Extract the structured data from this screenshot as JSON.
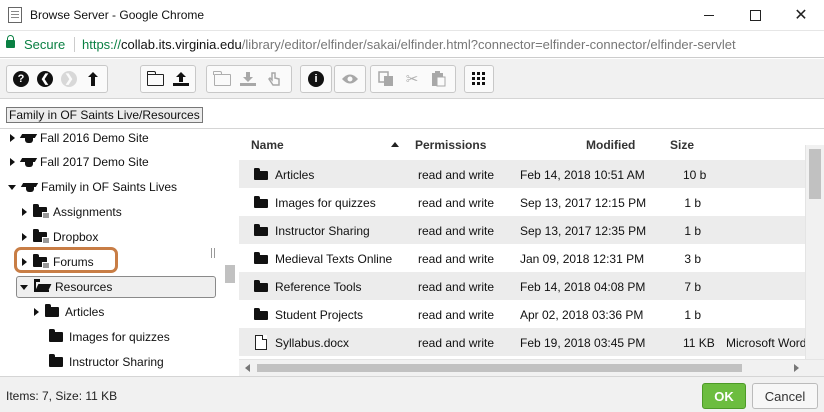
{
  "window": {
    "title": "Browse Server - Google Chrome",
    "controls": {
      "minimize": "minimize",
      "maximize": "maximize",
      "close": "✕"
    }
  },
  "address": {
    "secure_label": "Secure",
    "url_scheme": "https://",
    "url_host": "collab.its.virginia.edu",
    "url_path": "/library/editor/elfinder/sakai/elfinder.html?connector=elfinder-connector/elfinder-servlet"
  },
  "toolbar": {
    "groups": [
      [
        "help-icon",
        "back-icon",
        "forward-icon",
        "up-icon"
      ],
      [
        "new-folder-icon",
        "upload-icon"
      ],
      [
        "open-icon",
        "download-icon",
        "getfile-icon"
      ],
      [
        "info-icon"
      ],
      [
        "preview-icon"
      ],
      [
        "copy-icon",
        "cut-icon",
        "paste-icon"
      ],
      [
        "view-icon"
      ]
    ]
  },
  "path": {
    "crumb": "Family in OF Saints Live/Resources"
  },
  "tree": {
    "items": [
      {
        "label": "Fall 2016 Demo Site",
        "icon": "site-icon"
      },
      {
        "label": "Fall 2017 Demo Site",
        "icon": "site-icon"
      },
      {
        "label": "Family in OF Saints Lives",
        "icon": "site-icon"
      },
      {
        "label": "Assignments",
        "icon": "folder-icon"
      },
      {
        "label": "Dropbox",
        "icon": "folder-icon"
      },
      {
        "label": "Forums",
        "icon": "folder-icon"
      },
      {
        "label": "Resources",
        "icon": "folder-open-icon"
      },
      {
        "label": "Articles",
        "icon": "folder-icon"
      },
      {
        "label": "Images for quizzes",
        "icon": "folder-icon"
      },
      {
        "label": "Instructor Sharing",
        "icon": "folder-icon"
      }
    ]
  },
  "files": {
    "columns": {
      "name": "Name",
      "permissions": "Permissions",
      "modified": "Modified",
      "size": "Size"
    },
    "rows": [
      {
        "name": "Articles",
        "permissions": "read and write",
        "modified": "Feb 14, 2018 10:51 AM",
        "size": "10 b",
        "kind": ""
      },
      {
        "name": "Images for quizzes",
        "permissions": "read and write",
        "modified": "Sep 13, 2017 12:15 PM",
        "size": "1 b",
        "kind": ""
      },
      {
        "name": "Instructor Sharing",
        "permissions": "read and write",
        "modified": "Sep 13, 2017 12:35 PM",
        "size": "1 b",
        "kind": ""
      },
      {
        "name": "Medieval Texts Online",
        "permissions": "read and write",
        "modified": "Jan 09, 2018 12:31 PM",
        "size": "3 b",
        "kind": ""
      },
      {
        "name": "Reference Tools",
        "permissions": "read and write",
        "modified": "Feb 14, 2018 04:08 PM",
        "size": "7 b",
        "kind": ""
      },
      {
        "name": "Student Projects",
        "permissions": "read and write",
        "modified": "Apr 02, 2018 03:36 PM",
        "size": "1 b",
        "kind": ""
      },
      {
        "name": "Syllabus.docx",
        "permissions": "read and write",
        "modified": "Feb 19, 2018 03:45 PM",
        "size": "11 KB",
        "kind": "Microsoft Word"
      }
    ]
  },
  "status": {
    "text": "Items: 7, Size: 11 KB"
  },
  "buttons": {
    "ok": "OK",
    "cancel": "Cancel"
  },
  "colors": {
    "secure": "#0a8043",
    "ok": "#6cbd3f",
    "highlight": "#c87d45"
  }
}
